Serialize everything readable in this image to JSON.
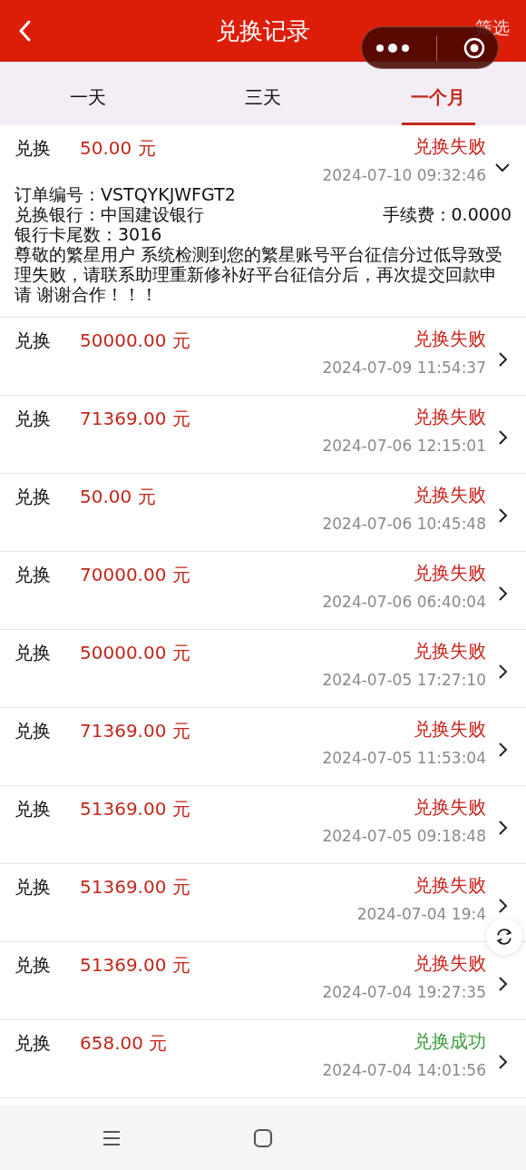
{
  "header": {
    "title": "兑换记录",
    "filter": "筛选"
  },
  "tabs": [
    {
      "label": "一天",
      "selected": false
    },
    {
      "label": "三天",
      "selected": false
    },
    {
      "label": "一个月",
      "selected": true
    }
  ],
  "records": [
    {
      "type": "兑换",
      "amount": "50.00 元",
      "status": "兑换失败",
      "success": false,
      "time": "2024-07-10 09:32:46",
      "expanded": true,
      "details": {
        "order": "订单编号：VSTQYKJWFGT2",
        "bank": "兑换银行：中国建设银行",
        "fee": "手续费：0.0000",
        "card": "银行卡尾数：3016",
        "message": "尊敬的繁星用户 系统检测到您的繁星账号平台征信分过低导致受理失败，请联系助理重新修补好平台征信分后，再次提交回款申请 谢谢合作！！！"
      }
    },
    {
      "type": "兑换",
      "amount": "50000.00 元",
      "status": "兑换失败",
      "success": false,
      "time": "2024-07-09 11:54:37",
      "expanded": false
    },
    {
      "type": "兑换",
      "amount": "71369.00 元",
      "status": "兑换失败",
      "success": false,
      "time": "2024-07-06 12:15:01",
      "expanded": false
    },
    {
      "type": "兑换",
      "amount": "50.00 元",
      "status": "兑换失败",
      "success": false,
      "time": "2024-07-06 10:45:48",
      "expanded": false
    },
    {
      "type": "兑换",
      "amount": "70000.00 元",
      "status": "兑换失败",
      "success": false,
      "time": "2024-07-06 06:40:04",
      "expanded": false
    },
    {
      "type": "兑换",
      "amount": "50000.00 元",
      "status": "兑换失败",
      "success": false,
      "time": "2024-07-05 17:27:10",
      "expanded": false
    },
    {
      "type": "兑换",
      "amount": "71369.00 元",
      "status": "兑换失败",
      "success": false,
      "time": "2024-07-05 11:53:04",
      "expanded": false
    },
    {
      "type": "兑换",
      "amount": "51369.00 元",
      "status": "兑换失败",
      "success": false,
      "time": "2024-07-05 09:18:48",
      "expanded": false
    },
    {
      "type": "兑换",
      "amount": "51369.00 元",
      "status": "兑换失败",
      "success": false,
      "time": "2024-07-04 19:4",
      "expanded": false
    },
    {
      "type": "兑换",
      "amount": "51369.00 元",
      "status": "兑换失败",
      "success": false,
      "time": "2024-07-04 19:27:35",
      "expanded": false
    },
    {
      "type": "兑换",
      "amount": "658.00 元",
      "status": "兑换成功",
      "success": true,
      "time": "2024-07-04 14:01:56",
      "expanded": false
    }
  ]
}
